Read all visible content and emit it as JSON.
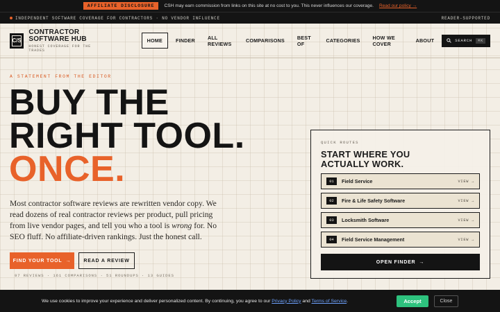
{
  "affiliate": {
    "tag": "AFFILIATE DISCLOSURE",
    "text": "CSH may earn commission from links on this site at no cost to you. This never influences our coverage.",
    "link": "Read our policy →"
  },
  "strip": {
    "left": "INDEPENDENT SOFTWARE COVERAGE FOR CONTRACTORS · NO VENDOR INFLUENCE",
    "right": "READER-SUPPORTED"
  },
  "logo": {
    "mark": "C/S",
    "title_line1": "CONTRACTOR",
    "title_line2": "SOFTWARE HUB",
    "subtitle": "HONEST COVERAGE FOR THE TRADES"
  },
  "nav": {
    "items": [
      "HOME",
      "FINDER",
      "ALL REVIEWS",
      "COMPARISONS",
      "BEST OF",
      "CATEGORIES",
      "HOW WE COVER",
      "ABOUT"
    ],
    "active": "HOME",
    "search_label": "SEARCH",
    "search_shortcut": "⌘K"
  },
  "hero": {
    "eyebrow": "A STATEMENT FROM THE EDITOR",
    "line1": "BUY THE",
    "line2": "RIGHT TOOL.",
    "line3": "ONCE.",
    "lede_before": "Most contractor software reviews are rewritten vendor copy. We read dozens of real contractor reviews per product, pull pricing from live vendor pages, and tell you who a tool is ",
    "lede_em": "wrong",
    "lede_after": " for. No SEO fluff. No affiliate-driven rankings. Just the honest call.",
    "primary_button": "FIND YOUR TOOL",
    "secondary_button": "READ A REVIEW",
    "stats": "97 REVIEWS · 161 COMPARISONS · 51 ROUNDUPS · 13 GUIDES"
  },
  "panel": {
    "eyebrow": "QUICK ROUTES",
    "title_line1": "START WHERE YOU",
    "title_line2": "ACTUALLY WORK.",
    "routes": [
      {
        "num": "01",
        "name": "Field Service",
        "action": "VIEW →"
      },
      {
        "num": "02",
        "name": "Fire & Life Safety Software",
        "action": "VIEW →"
      },
      {
        "num": "03",
        "name": "Locksmith Software",
        "action": "VIEW →"
      },
      {
        "num": "04",
        "name": "Field Service Management",
        "action": "VIEW →"
      }
    ],
    "cta": "OPEN FINDER"
  },
  "cookie": {
    "text_before": "We use cookies to improve your experience and deliver personalized content. By continuing, you agree to our ",
    "privacy": "Privacy Policy",
    "and": " and ",
    "terms": "Terms of Service",
    "period": ".",
    "accept": "Accept",
    "close": "Close"
  },
  "icons": {
    "arrow": "→"
  },
  "colors": {
    "accent": "#e8622a",
    "dark": "#141414",
    "paper": "#f3eee5",
    "accept_green": "#2ec27e"
  }
}
